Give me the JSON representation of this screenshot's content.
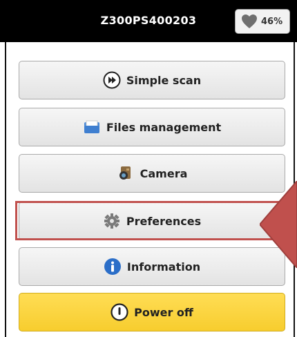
{
  "device": {
    "name": "Z300PS400203",
    "battery": "46%"
  },
  "menu": {
    "simple_scan": "Simple scan",
    "files_management": "Files management",
    "camera": "Camera",
    "preferences": "Preferences",
    "information": "Information",
    "power_off": "Power off"
  },
  "colors": {
    "highlight": "#c0504d",
    "power": "#f7cd2e"
  }
}
